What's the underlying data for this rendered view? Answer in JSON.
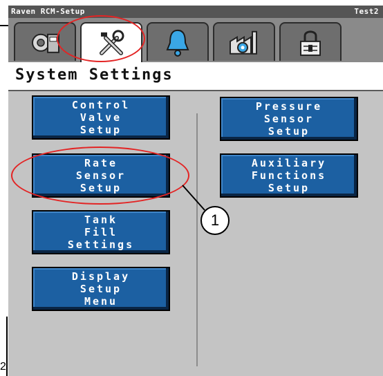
{
  "titlebar": {
    "app_title": "Raven RCM-Setup",
    "right_label": "Test2"
  },
  "tabs": [
    {
      "icon": "machine-gear-icon",
      "active": false
    },
    {
      "icon": "tools-icon",
      "active": true
    },
    {
      "icon": "alarm-bell-icon",
      "active": false
    },
    {
      "icon": "factory-gear-icon",
      "active": false
    },
    {
      "icon": "lock-icon",
      "active": false
    }
  ],
  "header": {
    "title": "System Settings"
  },
  "buttons": {
    "control_valve": "Control\nValve\nSetup",
    "rate_sensor": "Rate\nSensor\nSetup",
    "tank_fill": "Tank\nFill\nSettings",
    "display_setup": "Display\nSetup\nMenu",
    "pressure_sensor": "Pressure\nSensor\nSetup",
    "auxiliary": "Auxiliary\nFunctions\nSetup"
  },
  "callout_number": "1",
  "figure_marker": "2",
  "colors": {
    "button_blue": "#1c60a2",
    "highlight_red": "#e32424",
    "background_gray": "#c4c4c4"
  }
}
